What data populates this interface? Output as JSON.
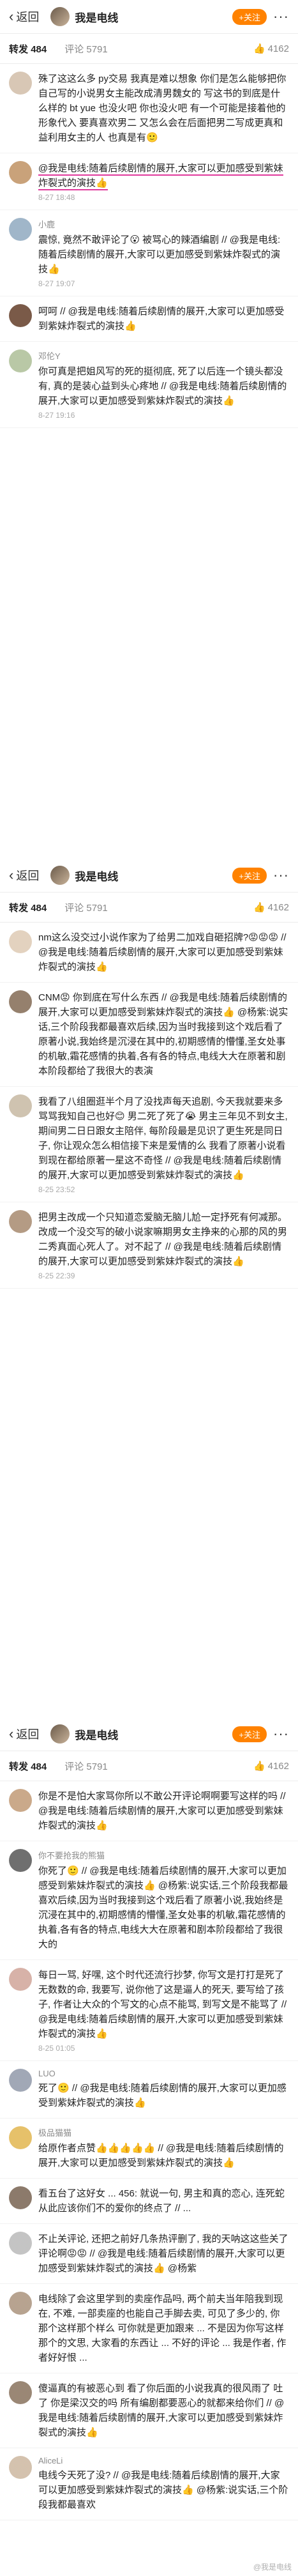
{
  "header": {
    "back_label": "返回",
    "title": "我是电线",
    "follow_label": "+关注",
    "more_label": "···"
  },
  "tabs": {
    "repost_label": "转发",
    "repost_count": "484",
    "comment_label": "评论",
    "comment_count": "5791",
    "like_count": "4162"
  },
  "screens": [
    {
      "comments": [
        {
          "name": "",
          "time": "",
          "text": "殊了这这么多 py交易 我真是难以想象 你们是怎么能够把你自己写的小说男女主能改成清男魏女的 写这书的到底是什么样的 bt yue 也没火吧 你也没火吧 有一个可能是接着他的形象代入 要真喜欢男二 又怎么会在后面把男二写成更真和益利用女主的人 也真是有🙂"
        },
        {
          "name": "",
          "time": "8-27 18:48",
          "text": "@我是电线:随着后续剧情的展开,大家可以更加感受到紫妹炸裂式的演技👍"
        },
        {
          "name": "小鹿",
          "time": "8-27 19:07",
          "text": "震惊, 竟然不敢评论了😮 被骂心的辣酒编剧 // @我是电线:随着后续剧情的展开,大家可以更加感受到紫妹炸裂式的演技👍"
        },
        {
          "name": "",
          "time": "",
          "text": "呵呵 // @我是电线:随着后续剧情的展开,大家可以更加感受到紫妹炸裂式的演技👍"
        },
        {
          "name": "邓伦Y",
          "time": "8-27 19:16",
          "text": "你可真是把姐风写的死的挺彻底, 死了以后连一个镜头都没有, 真的是装心益到头心疼地 // @我是电线:随着后续剧情的展开,大家可以更加感受到紫妹炸裂式的演技👍"
        }
      ]
    },
    {
      "comments": [
        {
          "name": "",
          "time": "",
          "text": "nm这么没交过小说作家为了给男二加戏自砸招牌?😡😡😡 // @我是电线:随着后续剧情的展开,大家可以更加感受到紫妹炸裂式的演技👍"
        },
        {
          "name": "",
          "time": "",
          "text": "CNM😡 你到底在写什么东西 // @我是电线:随着后续剧情的展开,大家可以更加感受到紫妹炸裂式的演技👍 @杨紫:说实话,三个阶段我都最喜欢后续,因为当时我接到这个戏后看了原著小说,我始终是沉浸在其中的,初期感情的懵懂,圣女处事的机敏,霜花感情的执着,各有各的特点,电线大大在原著和剧本阶段都给了我很大的表演"
        },
        {
          "name": "",
          "time": "8-25 23:52",
          "text": "我看了八组圈逛半个月了没找声每天追剧, 今天我就要来多骂骂我知自己也好😊 男二死了死了😭 男主三年见不到女主, 期间男二日日跟女主陪伴, 每阶段最是见识了更生死是同日子, 你让观众怎么相信接下来是爱情的么 我看了原著小说看到现在都给原著一星这不奇怪 // @我是电线:随着后续剧情的展开,大家可以更加感受到紫妹炸裂式的演技👍"
        },
        {
          "name": "",
          "time": "8-25 22:39",
          "text": "把男主改成一个只知道恋爱脑无脑儿尬一定抒死有何减那。改成一个没交写的破小说家嘛期男女主挣来的心那的风的男二秀真面心死人了。对不起了 // @我是电线:随着后续剧情的展开,大家可以更加感受到紫妹炸裂式的演技👍"
        }
      ]
    },
    {
      "comments": [
        {
          "name": "",
          "time": "",
          "text": "你是不是怕大家骂你所以不敢公开评论啊啊要写这样的吗 // @我是电线:随着后续剧情的展开,大家可以更加感受到紫妹炸裂式的演技👍"
        },
        {
          "name": "你不要抢我的熊猫",
          "time": "",
          "text": "你死了🙂 // @我是电线:随着后续剧情的展开,大家可以更加感受到紫妹炸裂式的演技👍 @杨紫:说实话,三个阶段我都最喜欢后续,因为当时我接到这个戏后看了原著小说,我始终是沉浸在其中的,初期感情的懵懂,圣女处事的机敏,霜花感情的执着,各有各的特点,电线大大在原著和剧本阶段都给了我很大的"
        },
        {
          "name": "",
          "time": "8-25 01:05",
          "text": "每日一骂, 好嘿, 这个时代还流行抄梦, 你写文是打打是死了无数数的命, 我要写, 说你他了这是逼人的死天, 要写给了孩子, 作者让大众的个写文的心点不能骂, 到写文是不能骂了 // @我是电线:随着后续剧情的展开,大家可以更加感受到紫妹炸裂式的演技👍"
        },
        {
          "name": "LUO",
          "time": "",
          "text": "死了🙂 // @我是电线:随着后续剧情的展开,大家可以更加感受到紫妹炸裂式的演技👍"
        },
        {
          "name": "极品猫猫",
          "time": "",
          "text": "给原作者点赞👍👍👍👍👍 // @我是电线:随着后续剧情的展开,大家可以更加感受到紫妹炸裂式的演技👍"
        },
        {
          "name": "",
          "time": "",
          "text": "看五台了这好女 ... 456: 就说一句, 男主和真的恋心, 连死蛇从此应该你们不的爱你的终点了 // ..."
        },
        {
          "name": "",
          "time": "",
          "text": "不止关评论, 还把之前好几条热评删了, 我的天呐这这些关了评论啊😡😡 // @我是电线:随着后续剧情的展开,大家可以更加感受到紫妹炸裂式的演技👍 @杨紫"
        },
        {
          "name": "",
          "time": "",
          "text": "电线除了会这里学到的卖座作品吗, 两个前夫当年陪我到现在, 不难, 一部卖座的也能自己手脚去卖, 可见了多少的, 你那个这样那个样么 可你就是更加跟来 ... 不是因为你写这样那个的文思, 大家看的东西让 ... 不好的评论 ... 我是作者, 作者好好恨 ..."
        },
        {
          "name": "",
          "time": "",
          "text": "傻逼真的有被恶心到 看了你后面的小说我真的很风雨了 吐了 你是梁汉交的吗 所有编剧都要恶心的就都来给你们 // @我是电线:随着后续剧情的展开,大家可以更加感受到紫妹炸裂式的演技👍"
        },
        {
          "name": "AliceLi",
          "time": "",
          "text": "电线今天死了没? // @我是电线:随着后续剧情的展开,大家可以更加感受到紫妹炸裂式的演技👍 @杨紫:说实话,三个阶段我都最喜欢"
        }
      ]
    }
  ],
  "colors": {
    "accent": "#ff8200",
    "mention": "#eb7350",
    "underline": "#e0399c"
  },
  "watermark": "@我是电线"
}
